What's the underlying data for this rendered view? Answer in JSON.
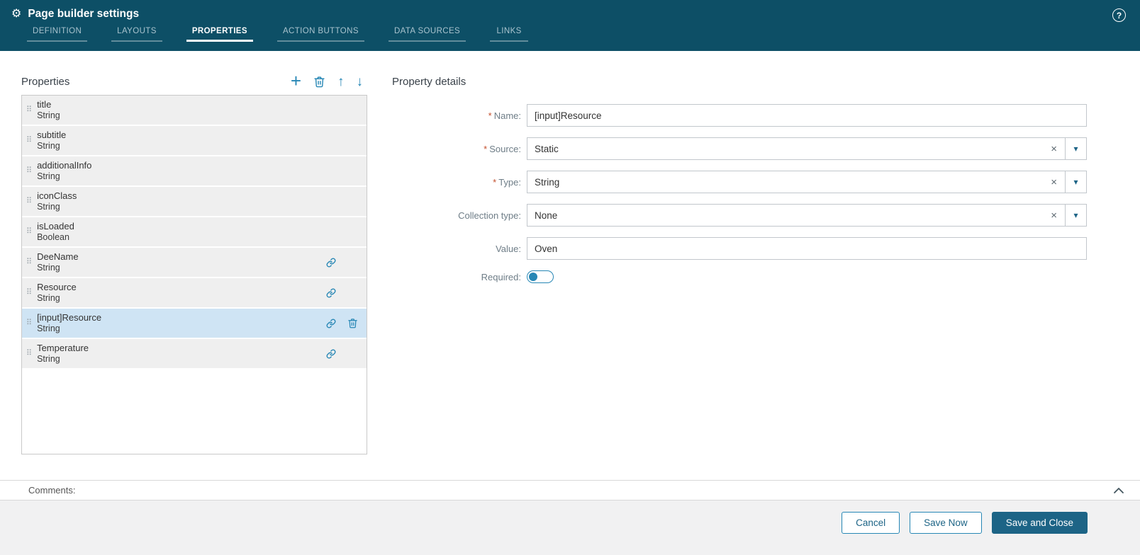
{
  "colors": {
    "header-bg": "#0d4f66",
    "accent": "#2787b5",
    "primary": "#1d6486",
    "selected-row": "#cfe4f4",
    "row-bg": "#efefef"
  },
  "icons": {
    "gear": "⚙",
    "help": "?",
    "add": "+",
    "move_up": "↑",
    "move_down": "↓",
    "drag": "⠿",
    "clear": "×",
    "caret": "▾"
  },
  "header": {
    "title": "Page builder settings",
    "tabs": [
      {
        "label": "DEFINITION",
        "active": false
      },
      {
        "label": "LAYOUTS",
        "active": false
      },
      {
        "label": "PROPERTIES",
        "active": true
      },
      {
        "label": "ACTION BUTTONS",
        "active": false
      },
      {
        "label": "DATA SOURCES",
        "active": false
      },
      {
        "label": "LINKS",
        "active": false
      }
    ]
  },
  "properties_panel": {
    "title": "Properties",
    "items": [
      {
        "name": "title",
        "type": "String",
        "linked": false,
        "selected": false
      },
      {
        "name": "subtitle",
        "type": "String",
        "linked": false,
        "selected": false
      },
      {
        "name": "additionalInfo",
        "type": "String",
        "linked": false,
        "selected": false
      },
      {
        "name": "iconClass",
        "type": "String",
        "linked": false,
        "selected": false
      },
      {
        "name": "isLoaded",
        "type": "Boolean",
        "linked": false,
        "selected": false
      },
      {
        "name": "DeeName",
        "type": "String",
        "linked": true,
        "selected": false
      },
      {
        "name": "Resource",
        "type": "String",
        "linked": true,
        "selected": false
      },
      {
        "name": "[input]Resource",
        "type": "String",
        "linked": true,
        "selected": true
      },
      {
        "name": "Temperature",
        "type": "String",
        "linked": true,
        "selected": false
      }
    ]
  },
  "details_panel": {
    "title": "Property details",
    "required_marker": "*",
    "fields": {
      "name": {
        "label": "Name:",
        "required": true,
        "value": "[input]Resource"
      },
      "source": {
        "label": "Source:",
        "required": true,
        "value": "Static"
      },
      "type": {
        "label": "Type:",
        "required": true,
        "value": "String"
      },
      "collection_type": {
        "label": "Collection type:",
        "required": false,
        "value": "None"
      },
      "value": {
        "label": "Value:",
        "required": false,
        "value": "Oven"
      },
      "required": {
        "label": "Required:",
        "state": "off"
      }
    }
  },
  "comments": {
    "label": "Comments:"
  },
  "footer": {
    "cancel": "Cancel",
    "save_now": "Save Now",
    "save_and_close": "Save and Close"
  }
}
